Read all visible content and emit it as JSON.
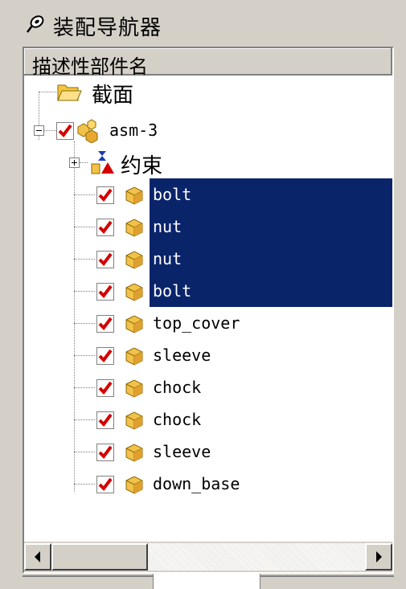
{
  "window": {
    "title": "装配导航器",
    "icon": "pin-icon"
  },
  "column_header": "描述性部件名",
  "tree": {
    "section_node": {
      "label": "截面",
      "icon": "folder-open-icon"
    },
    "root": {
      "label": "asm-3",
      "checked": true,
      "icon": "assembly-icon"
    },
    "constraints": {
      "label": "约束",
      "icon": "constraint-icon"
    },
    "parts": [
      {
        "label": "bolt",
        "selected": true
      },
      {
        "label": "nut",
        "selected": true
      },
      {
        "label": "nut",
        "selected": true
      },
      {
        "label": "bolt",
        "selected": true
      },
      {
        "label": "top_cover",
        "selected": false
      },
      {
        "label": "sleeve",
        "selected": false
      },
      {
        "label": "chock",
        "selected": false
      },
      {
        "label": "chock",
        "selected": false
      },
      {
        "label": "sleeve",
        "selected": false
      },
      {
        "label": "down_base",
        "selected": false
      }
    ]
  },
  "colors": {
    "selection": "#0a246a",
    "check": "#d40000",
    "part": "#f2c14a"
  }
}
